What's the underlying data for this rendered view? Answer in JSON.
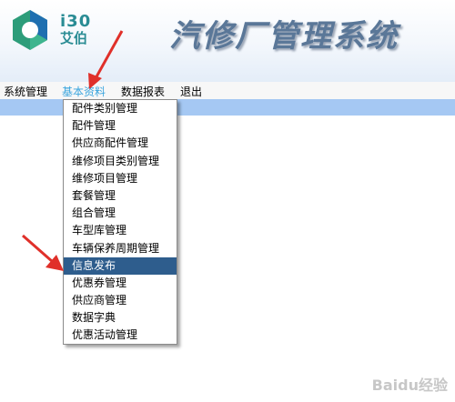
{
  "header": {
    "brand_line1": "i30",
    "brand_line2": "艾伯",
    "title": "汽修厂管理系统"
  },
  "menubar": {
    "items": [
      {
        "label": "系统管理"
      },
      {
        "label": "基本资料"
      },
      {
        "label": "数据报表"
      },
      {
        "label": "退出"
      }
    ],
    "active_index": 1
  },
  "dropdown": {
    "items": [
      {
        "label": "配件类别管理"
      },
      {
        "label": "配件管理"
      },
      {
        "label": "供应商配件管理"
      },
      {
        "label": "维修项目类别管理"
      },
      {
        "label": "维修项目管理"
      },
      {
        "label": "套餐管理"
      },
      {
        "label": "组合管理"
      },
      {
        "label": "车型库管理"
      },
      {
        "label": "车辆保养周期管理"
      },
      {
        "label": "信息发布"
      },
      {
        "label": "优惠券管理"
      },
      {
        "label": "供应商管理"
      },
      {
        "label": "数据字典"
      },
      {
        "label": "优惠活动管理"
      }
    ],
    "selected_index": 9
  },
  "watermark": "Baidu经验",
  "colors": {
    "menu_active": "#3aa5de",
    "band": "#a5c8f3",
    "selection": "#2e5d8d",
    "annotation_arrow": "#e0302a",
    "logo_green": "#2d9d7a",
    "logo_blue": "#1f6fb0"
  }
}
